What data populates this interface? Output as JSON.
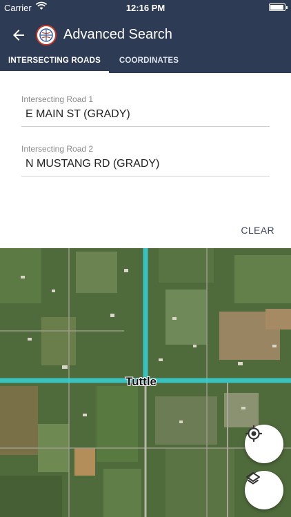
{
  "status_bar": {
    "carrier": "Carrier",
    "time": "12:16 PM"
  },
  "header": {
    "title": "Advanced Search",
    "tabs": [
      {
        "label": "INTERSECTING ROADS",
        "active": true
      },
      {
        "label": "COORDINATES",
        "active": false
      }
    ]
  },
  "form": {
    "road1": {
      "label": "Intersecting Road 1",
      "value": "E MAIN ST (GRADY)"
    },
    "road2": {
      "label": "Intersecting Road 2",
      "value": "N MUSTANG RD (GRADY)"
    },
    "clear_label": "CLEAR"
  },
  "map": {
    "place_label": "Tuttle",
    "highlight_color": "#36d1d8",
    "buttons": [
      "locate-icon",
      "layers-icon"
    ]
  },
  "colors": {
    "app_bar": "#2e3b55",
    "accent": "#36d1d8"
  }
}
